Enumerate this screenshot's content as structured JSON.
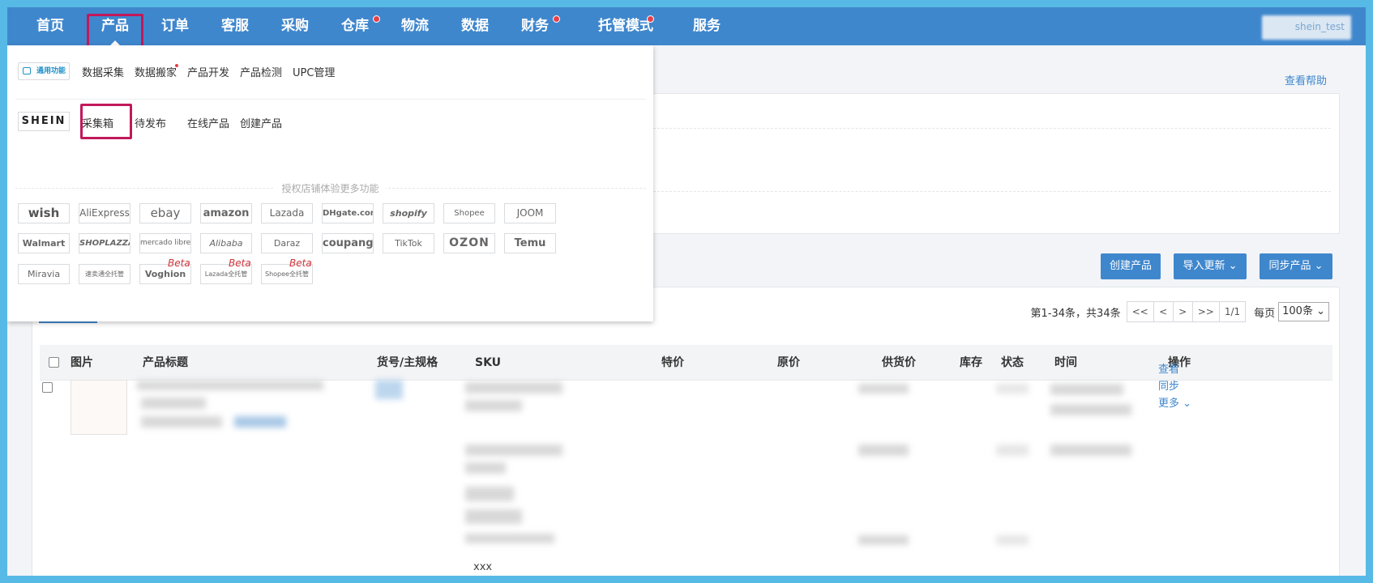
{
  "nav": {
    "items": [
      {
        "label": "首页",
        "dot": false
      },
      {
        "label": "产品",
        "dot": false
      },
      {
        "label": "订单",
        "dot": false
      },
      {
        "label": "客服",
        "dot": false
      },
      {
        "label": "采购",
        "dot": false
      },
      {
        "label": "仓库",
        "dot": true
      },
      {
        "label": "物流",
        "dot": false
      },
      {
        "label": "数据",
        "dot": false
      },
      {
        "label": "财务",
        "dot": true
      },
      {
        "label": "托管模式",
        "dot": true
      },
      {
        "label": "服务",
        "dot": false
      }
    ],
    "active": "产品",
    "user": "shein_test"
  },
  "dropdown": {
    "general_tag": "通用功能",
    "general_items": [
      "数据采集",
      "数据搬家",
      "产品开发",
      "产品检测",
      "UPC管理"
    ],
    "shein_logo": "SHEIN",
    "shein_items": [
      "采集箱",
      "待发布",
      "在线产品",
      "创建产品"
    ],
    "auth_text": "授权店铺体验更多功能",
    "platforms": [
      [
        "wish",
        "AliExpress",
        "ebay",
        "amazon",
        "Lazada",
        "DHgate.com",
        "shopify",
        "Shopee",
        "JOOM"
      ],
      [
        "Walmart",
        "SHOPLAZZA",
        "mercado libre",
        "Alibaba",
        "Daraz",
        "coupang",
        "TikTok",
        "OZON",
        "Temu"
      ],
      [
        "Miravia",
        "速卖通全托管",
        "Voghion",
        "Lazada全托管",
        "Shopee全托管"
      ]
    ],
    "beta_label": "Beta"
  },
  "page": {
    "help_link": "查看帮助",
    "buttons": {
      "create": "创建产品",
      "import": "导入更新",
      "sync": "同步产品"
    },
    "pager": {
      "summary": "第1-34条，共34条",
      "first": "<<",
      "prev": "<",
      "next": ">",
      "last": ">>",
      "page": "1/1",
      "per_page_label": "每页",
      "per_page": "100条"
    },
    "table": {
      "headers": [
        "图片",
        "产品标题",
        "货号/主规格",
        "SKU",
        "特价",
        "原价",
        "供货价",
        "库存",
        "状态",
        "时间",
        "操作"
      ],
      "row_actions": [
        "查看",
        "同步",
        "更多"
      ],
      "sku_tail": "xxx"
    }
  }
}
